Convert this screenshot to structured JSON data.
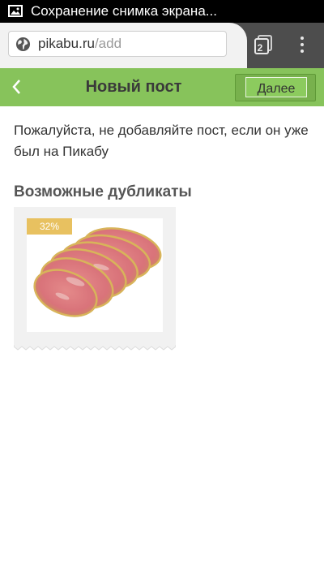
{
  "status_bar": {
    "notification_icon": "image-icon",
    "text": "Сохранение снимка экрана..."
  },
  "browser": {
    "url_domain": "pikabu.ru",
    "url_path": "/add",
    "tab_count": "2",
    "site_icon": "globe-icon",
    "menu_icon": "more-vert-icon"
  },
  "header": {
    "back_icon": "chevron-left-icon",
    "title": "Новый пост",
    "next_label": "Далее",
    "colors": {
      "bar": "#87c35b",
      "button": "#78b14d"
    }
  },
  "content": {
    "notice": "Пожалуйста, не добавляйте пост, если он уже был на Пикабу",
    "duplicates_title": "Возможные дубликаты",
    "duplicates": [
      {
        "match": "32%",
        "image": "raw-meat-steaks"
      }
    ]
  }
}
